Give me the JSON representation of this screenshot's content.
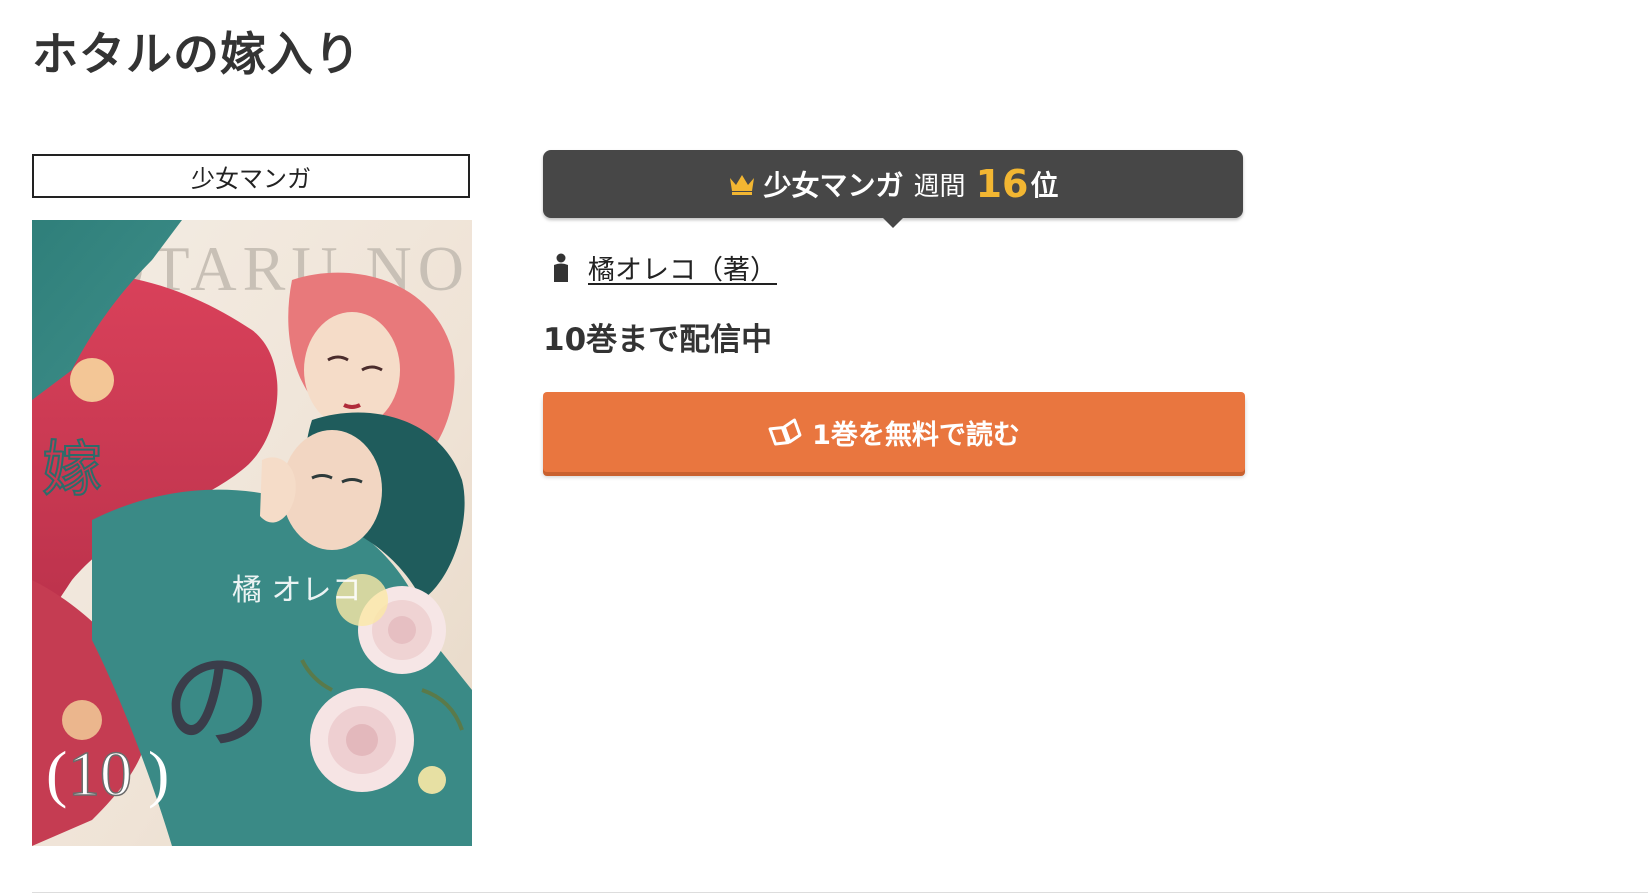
{
  "page": {
    "title": "ホタルの嫁入り"
  },
  "genre_tag": {
    "label": "少女マンガ"
  },
  "cover": {
    "alt": "ホタルの嫁入り 10",
    "title_text": "ホタルの嫁入り",
    "roman_title": "HOTARU NO YOMEIRI",
    "author_mark": "橘 オレコ",
    "volume": "10"
  },
  "ranking": {
    "icon": "crown-icon",
    "genre": "少女マンガ",
    "period": "週間",
    "rank": "16",
    "suffix": "位",
    "accent_color": "#f2b632",
    "bg_color": "#474747"
  },
  "author": {
    "icon": "person-icon",
    "label": "橘オレコ（著）"
  },
  "volume_status": "10巻まで配信中",
  "read_button": {
    "icon": "book-icon",
    "label": "1巻を無料で読む",
    "color": "#e9763f"
  }
}
